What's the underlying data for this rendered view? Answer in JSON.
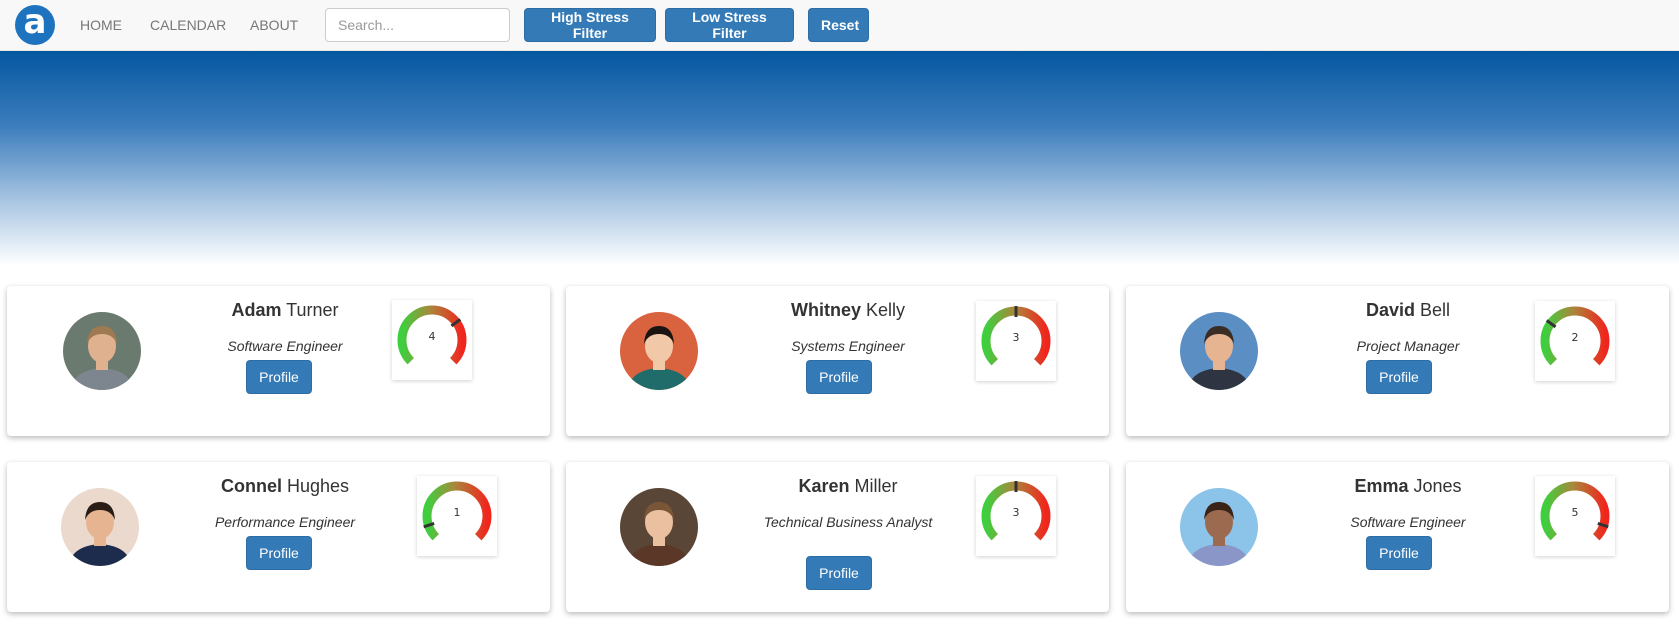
{
  "nav": {
    "logo_letter": "a",
    "links": [
      "HOME",
      "CALENDAR",
      "ABOUT"
    ],
    "search_placeholder": "Search...",
    "buttons": [
      "High Stress Filter",
      "Low Stress Filter",
      "Reset"
    ]
  },
  "colors": {
    "primary_button": "#337ab7",
    "hero_top": "#0457a0",
    "gauge_low": "#3ecf3e",
    "gauge_high": "#f0261e"
  },
  "cards": [
    {
      "first": "Adam",
      "last": "Turner",
      "role": "Software Engineer",
      "button": "Profile",
      "stress": 4,
      "stress_label": "4"
    },
    {
      "first": "Whitney",
      "last": "Kelly",
      "role": "Systems Engineer",
      "button": "Profile",
      "stress": 3,
      "stress_label": "3"
    },
    {
      "first": "David",
      "last": "Bell",
      "role": "Project Manager",
      "button": "Profile",
      "stress": 2,
      "stress_label": "2"
    },
    {
      "first": "Connel",
      "last": "Hughes",
      "role": "Performance Engineer",
      "button": "Profile",
      "stress": 1,
      "stress_label": "1"
    },
    {
      "first": "Karen",
      "last": "Miller",
      "role": "Technical Business Analyst",
      "button": "Profile",
      "stress": 3,
      "stress_label": "3"
    },
    {
      "first": "Emma",
      "last": "Jones",
      "role": "Software Engineer",
      "button": "Profile",
      "stress": 5,
      "stress_label": "5"
    }
  ]
}
